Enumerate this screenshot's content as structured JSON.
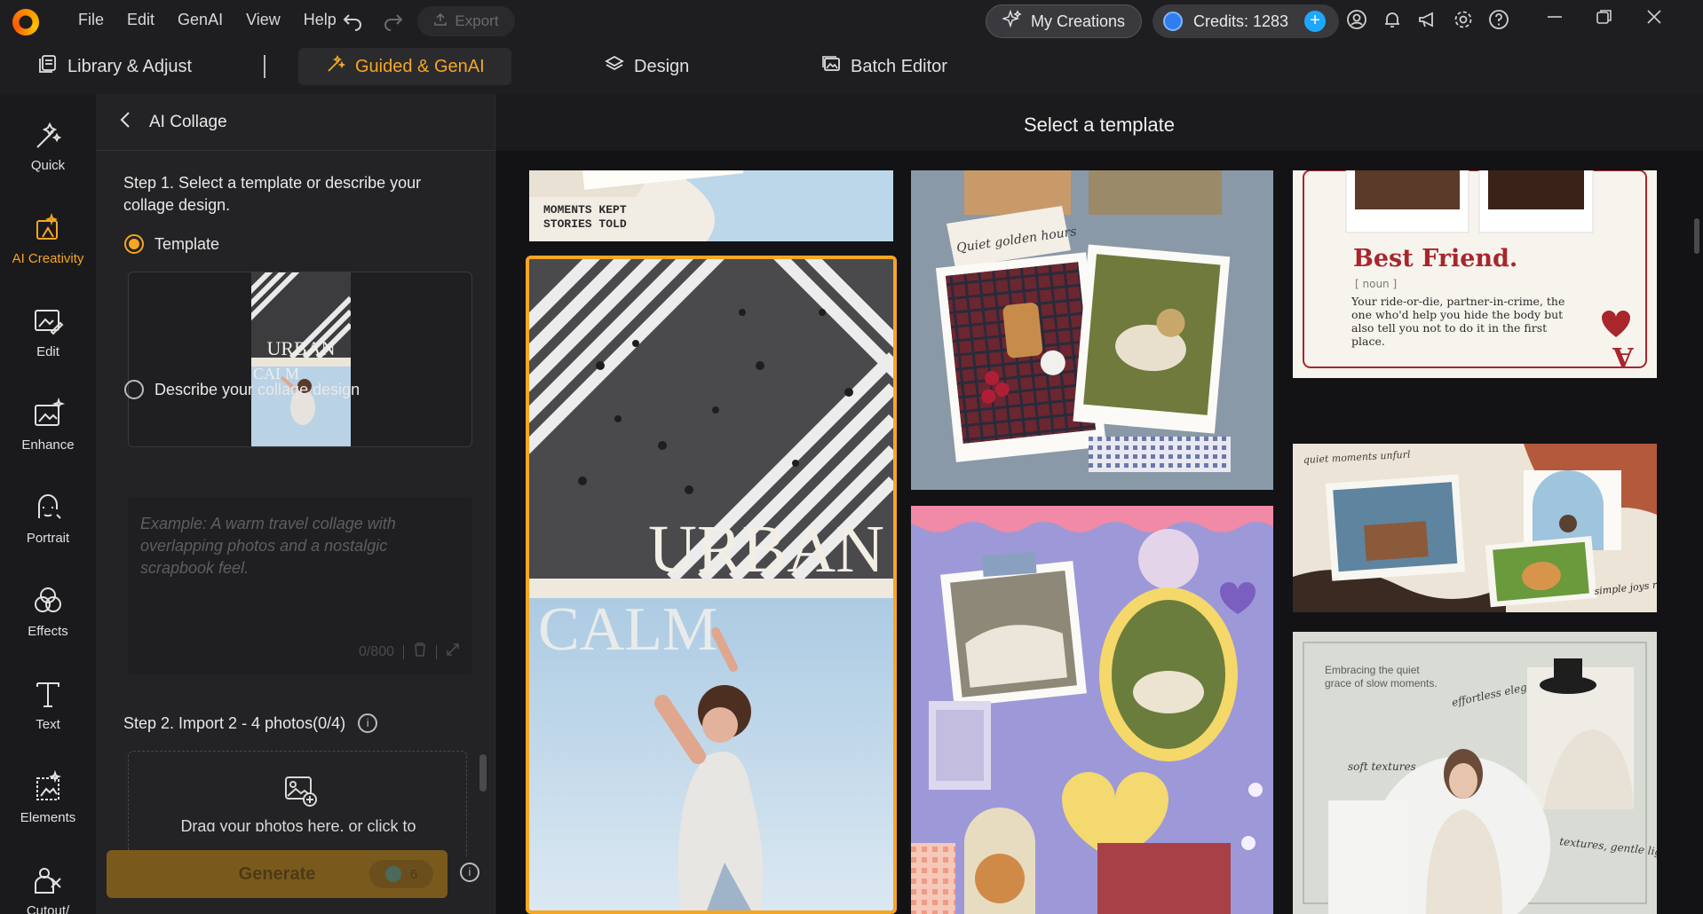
{
  "app": {
    "menus": [
      "File",
      "Edit",
      "GenAI",
      "View",
      "Help"
    ],
    "export_label": "Export",
    "my_creations_label": "My Creations",
    "credits_label": "Credits: 1283"
  },
  "modes": {
    "library": "Library & Adjust",
    "guided": "Guided & GenAI",
    "design": "Design",
    "batch": "Batch Editor",
    "active": "Guided & GenAI"
  },
  "sidebar": {
    "items": [
      {
        "label": "Quick",
        "icon": "magic-wand-icon"
      },
      {
        "label": "AI Creativity",
        "icon": "ai-creativity-icon",
        "active": true
      },
      {
        "label": "Edit",
        "icon": "edit-image-icon"
      },
      {
        "label": "Enhance",
        "icon": "enhance-icon"
      },
      {
        "label": "Portrait",
        "icon": "portrait-icon"
      },
      {
        "label": "Effects",
        "icon": "effects-icon"
      },
      {
        "label": "Text",
        "icon": "text-icon"
      },
      {
        "label": "Elements",
        "icon": "elements-icon"
      },
      {
        "label": "Cutout/",
        "icon": "cutout-icon"
      }
    ]
  },
  "panel": {
    "title": "AI Collage",
    "step1": "Step 1. Select a template or describe your collage design.",
    "option_template": "Template",
    "option_describe": "Describe your collage design",
    "selected_option": "Template",
    "describe_placeholder": "Example: A warm travel collage with overlapping photos and a nostalgic scrapbook feel.",
    "describe_counter": "0/800",
    "step2": "Step 2. Import 2 - 4 photos(0/4)",
    "drop_text": "Drag your photos here, or click to",
    "generate_label": "Generate",
    "generate_cost": "6",
    "thumb_text_top": "URBAN",
    "thumb_text_bottom": "CALM"
  },
  "gallery": {
    "title": "Select a template",
    "cards": {
      "moments": "MOMENTS KEPT\nSTORIES TOLD",
      "urban": "URBAN",
      "calm": "CALM",
      "golden": "Quiet golden hours",
      "best_friend_title": "Best Friend.",
      "best_friend_noun": "[ noun ]",
      "best_friend_body": "Your ride-or-die, partner-in-crime, the one who'd help you hide the body but also tell you not to do it in the first place.",
      "best_friend_card": "A",
      "quiet_moments": "quiet moments unfurl",
      "simple_joys": "simple joys remain",
      "embracing": "Embracing the quiet grace of slow moments.",
      "effortless": "effortless elegance",
      "soft_textures": "soft textures, gentle light",
      "textures": "textures, gentle light"
    }
  },
  "colors": {
    "accent": "#f5a623",
    "background": "#1c1c1e",
    "panel": "#232325",
    "selection_border": "#f5a623"
  }
}
